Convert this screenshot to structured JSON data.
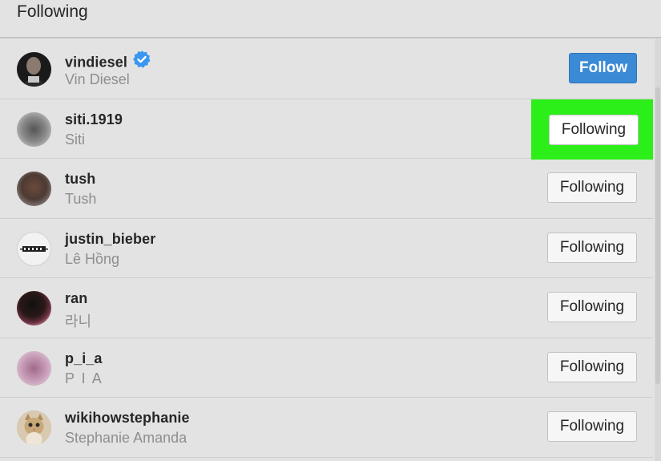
{
  "header": {
    "title": "Following"
  },
  "colors": {
    "accent": "#3a8ad6",
    "highlight": "#2cee19",
    "verified": "#3897f0"
  },
  "rows": [
    {
      "username": "vindiesel",
      "fullname": "Vin Diesel",
      "verified": true,
      "button": "Follow",
      "avatar": "dark-photo"
    },
    {
      "username": "siti.1919",
      "fullname": "Siti",
      "verified": false,
      "button": "Following",
      "highlighted": true,
      "avatar": "blurred-gray"
    },
    {
      "username": "tush",
      "fullname": "Tush",
      "verified": false,
      "button": "Following",
      "avatar": "blurred-brown"
    },
    {
      "username": "justin_bieber",
      "fullname": "Lê Hồng",
      "verified": false,
      "button": "Following",
      "avatar": "logo-text"
    },
    {
      "username": "ran",
      "fullname": "라니",
      "verified": false,
      "button": "Following",
      "avatar": "blurred-dark-red"
    },
    {
      "username": "p_i_a",
      "fullname": "P I A",
      "verified": false,
      "button": "Following",
      "avatar": "blurred-pink"
    },
    {
      "username": "wikihowstephanie",
      "fullname": "Stephanie Amanda",
      "verified": false,
      "button": "Following",
      "avatar": "cat-photo"
    }
  ]
}
